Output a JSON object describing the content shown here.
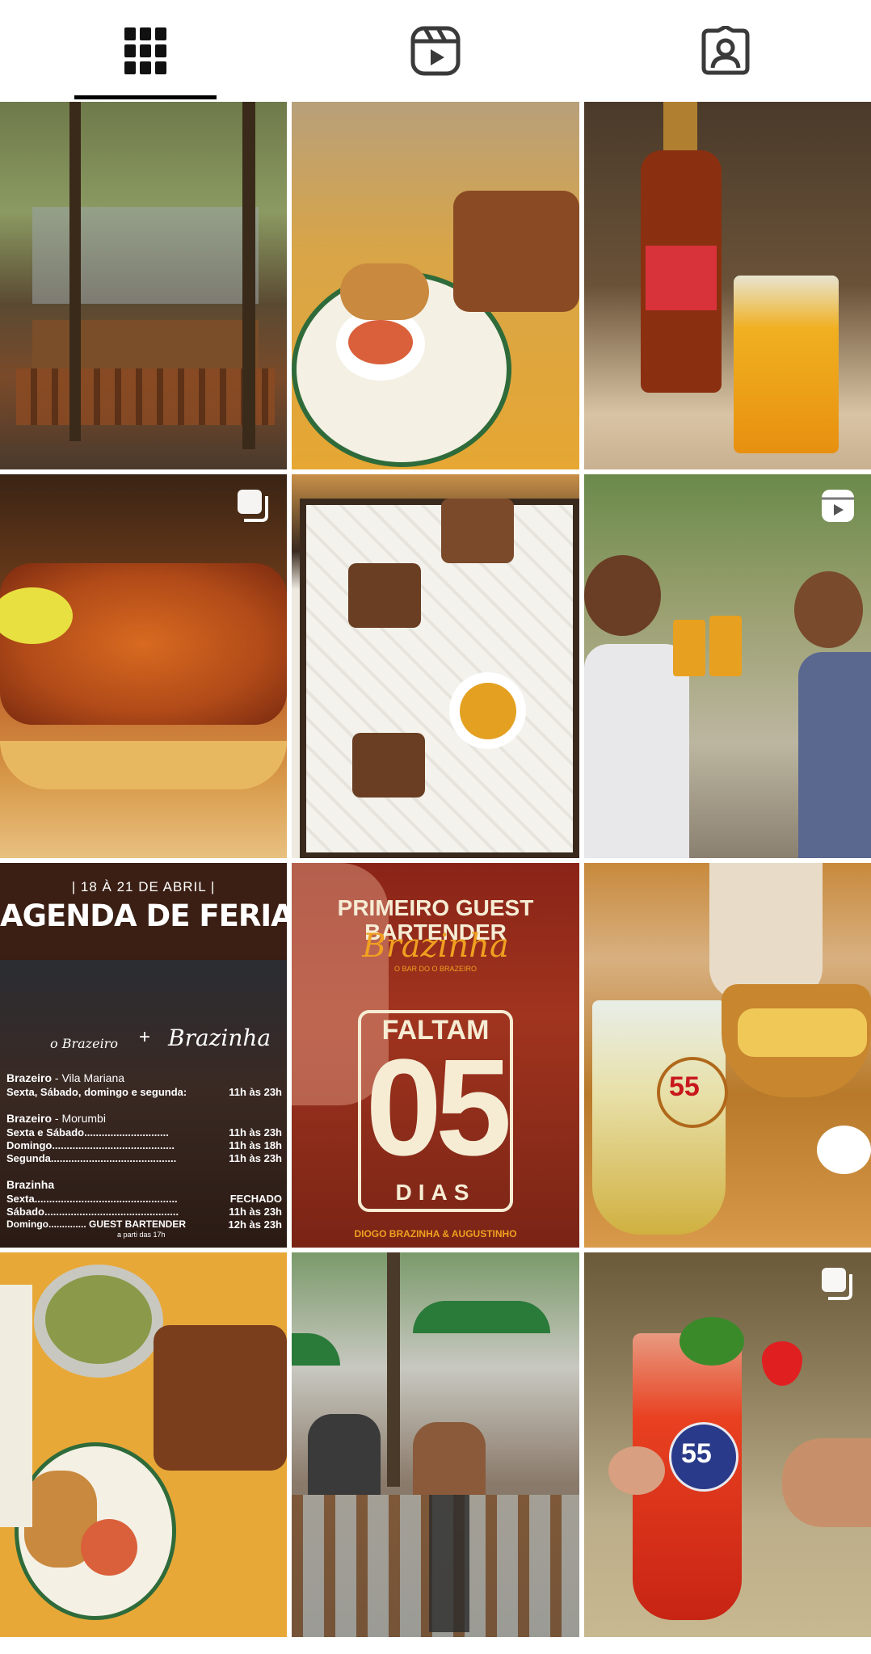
{
  "tabs": [
    {
      "name": "tab-posts",
      "icon": "grid-icon",
      "active": true
    },
    {
      "name": "tab-reels",
      "icon": "reels-icon",
      "active": false
    },
    {
      "name": "tab-tagged",
      "icon": "tagged-user-icon",
      "active": false
    }
  ],
  "colors": {
    "indicator": "#000000",
    "icon": "#111111",
    "icon_inactive": "#3a3a3a"
  },
  "posts": [
    {
      "id": 1,
      "subject": "outdoor-terrace-photo",
      "badge": null
    },
    {
      "id": 2,
      "subject": "food-table-photo",
      "badge": null
    },
    {
      "id": 3,
      "subject": "drink-bottle-photo",
      "badge": null
    },
    {
      "id": 4,
      "subject": "fried-shrimp-photo",
      "badge": "carousel-icon"
    },
    {
      "id": 5,
      "subject": "appetizer-board-photo",
      "badge": null
    },
    {
      "id": 6,
      "subject": "bartenders-toast-photo",
      "badge": "reel-icon"
    },
    {
      "id": 7,
      "subject": "holiday-schedule-graphic",
      "badge": null
    },
    {
      "id": 8,
      "subject": "guest-bartender-countdown-graphic",
      "badge": null
    },
    {
      "id": 9,
      "subject": "caipirinha-snacks-photo",
      "badge": null
    },
    {
      "id": 10,
      "subject": "food-spread-photo",
      "badge": null
    },
    {
      "id": 11,
      "subject": "street-terrace-photo",
      "badge": null
    },
    {
      "id": 12,
      "subject": "strawberry-drink-photo",
      "badge": "carousel-icon"
    }
  ],
  "post7": {
    "date_range": "| 18 À 21 DE ABRIL |",
    "headline": "AGENDA DE FERIADO",
    "logo_left": "o Brazeiro",
    "plus": "+",
    "logo_right": "Brazinha",
    "sections": [
      {
        "title": "Brazeiro",
        "subtitle": " - Vila Mariana",
        "lines": [
          {
            "left": "Sexta, Sábado, domingo e segunda:",
            "right": "11h às 23h"
          }
        ]
      },
      {
        "title": "Brazeiro",
        "subtitle": " - Morumbi",
        "lines": [
          {
            "left": "Sexta e Sábado.............................",
            "right": "11h às 23h"
          },
          {
            "left": "Domingo..........................................",
            "right": "11h às 18h"
          },
          {
            "left": "Segunda...........................................",
            "right": "11h às 23h"
          }
        ]
      },
      {
        "title": "Brazinha",
        "subtitle": "",
        "lines": [
          {
            "left": "Sexta.................................................",
            "right": "FECHADO"
          },
          {
            "left": "Sábado..............................................",
            "right": "11h às 23h"
          },
          {
            "left": "Domingo.............. GUEST BARTENDER",
            "right": "12h às 23h"
          }
        ]
      }
    ],
    "footnote": "a parti das 17h"
  },
  "post8": {
    "line1": "PRIMEIRO GUEST",
    "line2": "BARTENDER",
    "script": "Brazinha",
    "small": "O BAR DO O BRAZEIRO",
    "faltam": "FALTAM",
    "number": "05",
    "dias": "DIAS",
    "names": "DIOGO  BRAZINHA  &  AUGUSTINHO"
  },
  "post9": {
    "glass_label": "55"
  },
  "post12": {
    "glass_label": "55"
  }
}
